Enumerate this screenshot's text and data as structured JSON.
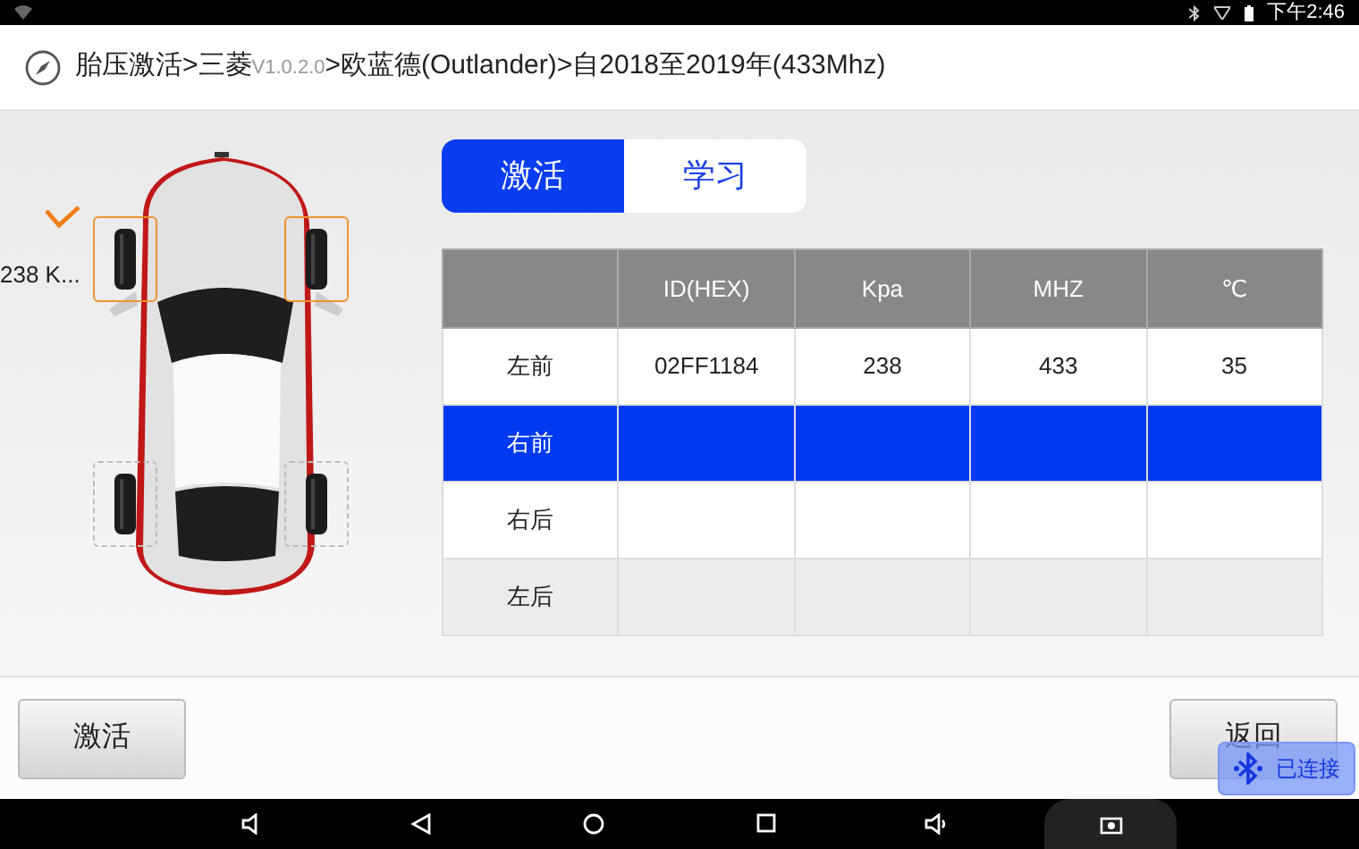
{
  "status_bar": {
    "time": "下午2:46"
  },
  "header": {
    "segments": [
      {
        "kind": "path",
        "text": "胎压激活>三菱"
      },
      {
        "kind": "version",
        "text": "V1.0.2.0"
      },
      {
        "kind": "path",
        "text": ">欧蓝德(Outlander)>自2018至2019年(433Mhz)"
      }
    ]
  },
  "tires": [
    {
      "highlighted": true,
      "checked": true,
      "reading": "238 K..."
    },
    {
      "highlighted": true,
      "checked": false
    },
    {
      "highlighted": false,
      "checked": false
    },
    {
      "highlighted": false,
      "checked": false
    }
  ],
  "tabs": [
    {
      "label": "激活",
      "selected": true
    },
    {
      "label": "学习",
      "selected": false
    }
  ],
  "table": {
    "columns": [
      "",
      "ID(HEX)",
      "Kpa",
      "MHZ",
      "℃"
    ],
    "rows": [
      {
        "selected": false,
        "shaded": false,
        "cells": [
          "左前",
          "02FF1184",
          "238",
          "433",
          "35"
        ]
      },
      {
        "selected": true,
        "shaded": false,
        "cells": [
          "右前",
          "",
          "",
          "",
          ""
        ]
      },
      {
        "selected": false,
        "shaded": false,
        "cells": [
          "右后",
          "",
          "",
          "",
          ""
        ]
      },
      {
        "selected": false,
        "shaded": true,
        "cells": [
          "左后",
          "",
          "",
          "",
          ""
        ]
      }
    ]
  },
  "buttons": [
    "激活",
    "返回"
  ],
  "bluetooth_badge": {
    "label": "已连接"
  }
}
